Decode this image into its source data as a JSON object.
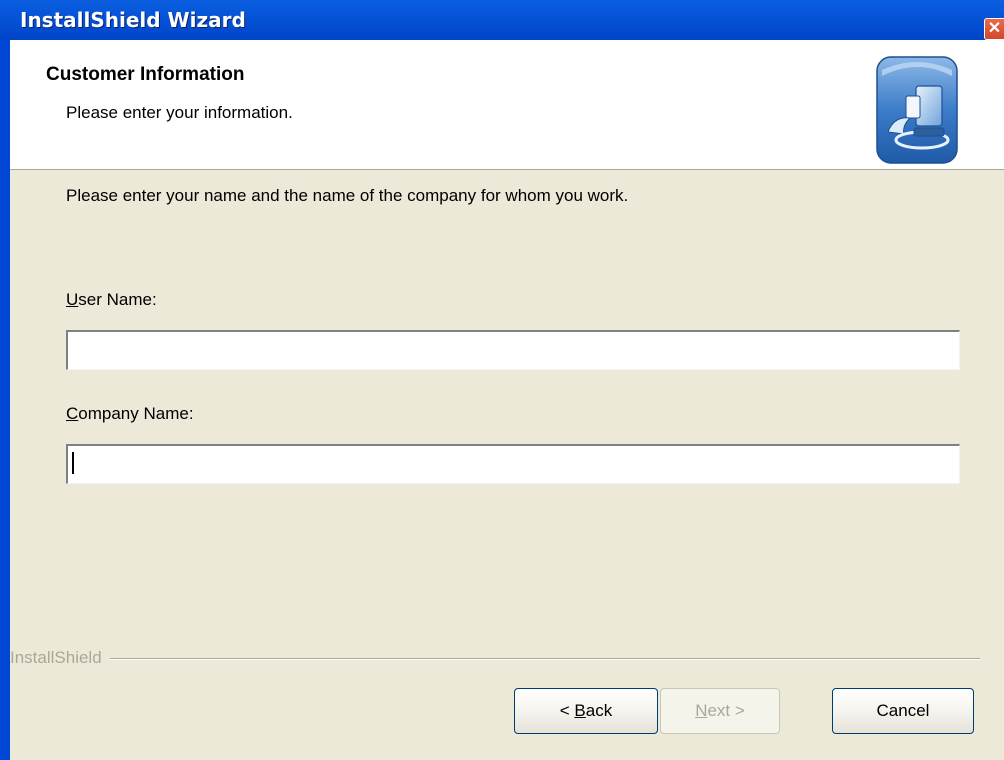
{
  "window": {
    "title": "InstallShield Wizard",
    "close_symbol": "✕"
  },
  "header": {
    "title": "Customer Information",
    "subtitle": "Please enter your information.",
    "logo_icon": "computer-setup-icon"
  },
  "body": {
    "instruction": "Please enter your name and the name of the company for whom you work."
  },
  "fields": {
    "user_name": {
      "label_accel": "U",
      "label_rest": "ser Name:",
      "value": ""
    },
    "company_name": {
      "label_accel": "C",
      "label_rest": "ompany Name:",
      "value": ""
    }
  },
  "footer": {
    "brand": "InstallShield"
  },
  "buttons": {
    "back": {
      "prefix": "< ",
      "accel": "B",
      "rest": "ack"
    },
    "next": {
      "accel": "N",
      "rest": "ext >",
      "disabled": true
    },
    "cancel": {
      "label": "Cancel"
    }
  },
  "colors": {
    "titlebar": "#0553D8",
    "dialog_bg": "#ECE9D8",
    "header_bg": "#FFFFFF",
    "disabled_text": "#ACA899"
  }
}
